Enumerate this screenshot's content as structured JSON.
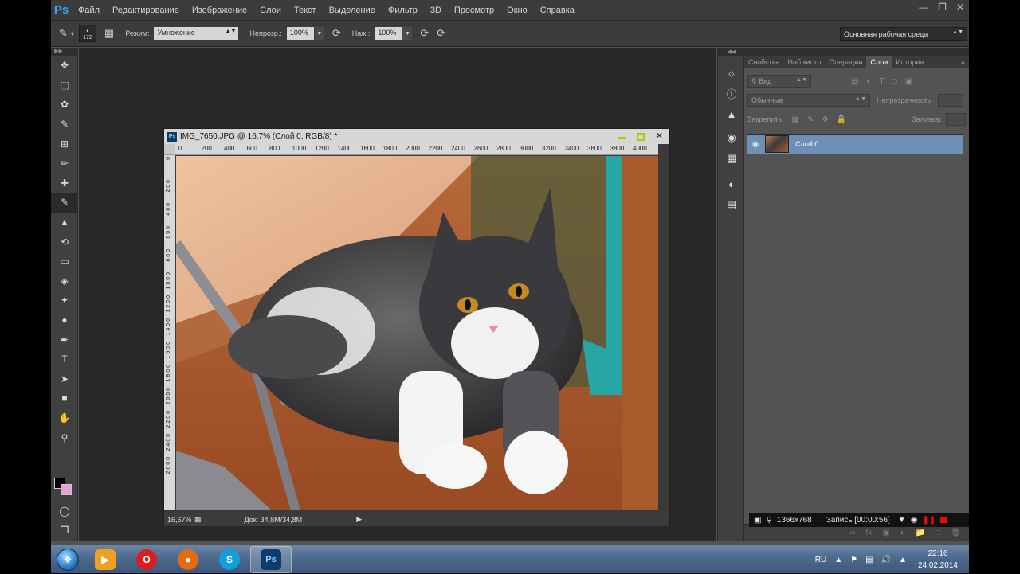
{
  "menubar": {
    "logo": "Ps",
    "items": [
      "Файл",
      "Редактирование",
      "Изображение",
      "Слои",
      "Текст",
      "Выделение",
      "Фильтр",
      "3D",
      "Просмотр",
      "Окно",
      "Справка"
    ]
  },
  "options": {
    "brush_size": "172",
    "mode_label": "Режим:",
    "mode_value": "Умножение",
    "opacity_label": "Непрозр.:",
    "opacity_value": "100%",
    "flow_label": "Наж.:",
    "flow_value": "100%",
    "workspace": "Основная рабочая среда"
  },
  "document": {
    "title": "IMG_7650.JPG @ 16,7% (Слой 0, RGB/8) *",
    "ruler_h": [
      "0",
      "200",
      "400",
      "600",
      "800",
      "1000",
      "1200",
      "1400",
      "1600",
      "1800",
      "2000",
      "2200",
      "2400",
      "2600",
      "2800",
      "3000",
      "3200",
      "3400",
      "3600",
      "3800",
      "4000"
    ],
    "ruler_v": [
      "0",
      "2 0 0",
      "4 0 0",
      "6 0 0",
      "8 0 0",
      "1 0 0 0",
      "1 2 0 0",
      "1 4 0 0",
      "1 6 0 0",
      "1 8 0 0",
      "2 0 0 0",
      "2 2 0 0",
      "2 4 0 0",
      "2 6 0 0"
    ],
    "zoom": "16,67%",
    "doc_info": "Док: 34,8M/34,8M"
  },
  "panel": {
    "tabs": [
      "Свойства",
      "Наб.кистр",
      "Операции",
      "Слои",
      "История"
    ],
    "active_tab": "Слои",
    "filter_kind": "Вид",
    "blend_mode": "Обычные",
    "opacity_label": "Непрозрачность:",
    "lock_label": "Закрепить:",
    "fill_label": "Заливка:",
    "layers": [
      {
        "name": "Слой 0",
        "visible": true,
        "selected": true
      }
    ]
  },
  "recorder": {
    "resolution": "1366x768",
    "time": "Запись [00:00:56]"
  },
  "taskbar": {
    "lang": "RU",
    "time": "22:16",
    "date": "24.02.2014"
  }
}
